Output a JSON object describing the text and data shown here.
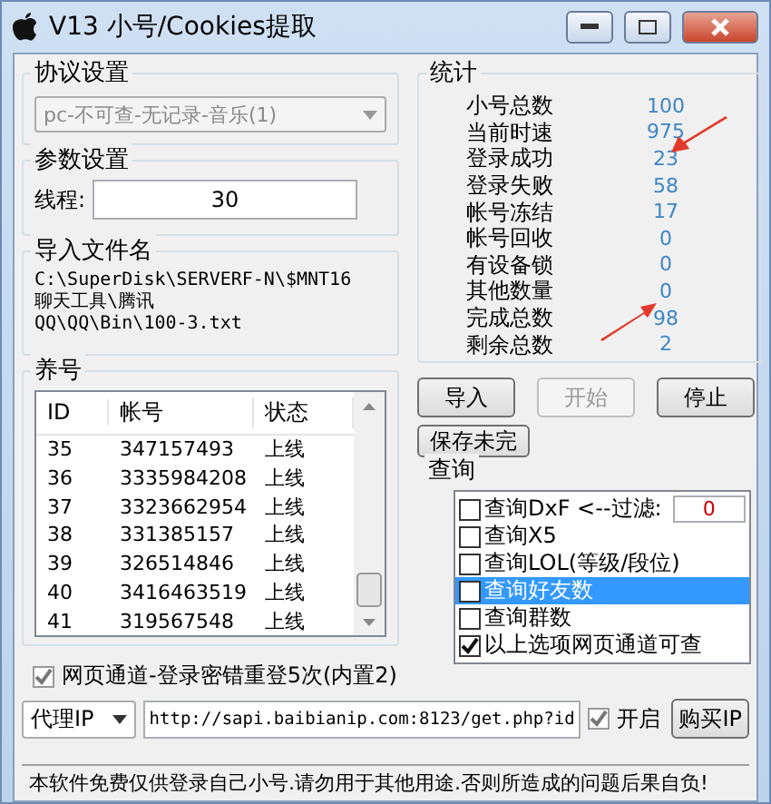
{
  "window": {
    "title": "V13 小号/Cookies提取"
  },
  "protocol": {
    "label": "协议设置",
    "value": "pc-不可查-无记录-音乐(1)",
    "disabled": true
  },
  "params": {
    "label": "参数设置",
    "thread_label": "线程:",
    "thread_value": "30"
  },
  "import_file": {
    "label": "导入文件名",
    "lines": [
      "C:\\SuperDisk\\SERVERF-N\\$MNT16",
      "聊天工具\\腾讯",
      "QQ\\QQ\\Bin\\100-3.txt"
    ]
  },
  "accounts": {
    "label": "养号",
    "columns": [
      "ID",
      "帐号",
      "状态"
    ],
    "rows": [
      [
        "35",
        "347157493",
        "上线"
      ],
      [
        "36",
        "3335984208",
        "上线"
      ],
      [
        "37",
        "3323662954",
        "上线"
      ],
      [
        "38",
        "331385157",
        "上线"
      ],
      [
        "39",
        "326514846",
        "上线"
      ],
      [
        "40",
        "3416463519",
        "上线"
      ],
      [
        "41",
        "319567548",
        "上线"
      ]
    ]
  },
  "stats": {
    "label": "统计",
    "items": [
      {
        "label": "小号总数",
        "value": "100"
      },
      {
        "label": "当前时速",
        "value": "975"
      },
      {
        "label": "登录成功",
        "value": "23"
      },
      {
        "label": "登录失败",
        "value": "58"
      },
      {
        "label": "帐号冻结",
        "value": "17"
      },
      {
        "label": "帐号回收",
        "value": "0"
      },
      {
        "label": "有设备锁",
        "value": "0"
      },
      {
        "label": "其他数量",
        "value": "0"
      },
      {
        "label": "完成总数",
        "value": "98"
      },
      {
        "label": "剩余总数",
        "value": "2"
      }
    ]
  },
  "buttons": [
    {
      "label": "导入",
      "disabled": false
    },
    {
      "label": "开始",
      "disabled": true
    },
    {
      "label": "停止",
      "disabled": false
    }
  ],
  "save_button": "保存未完",
  "query": {
    "label": "查询",
    "items": [
      {
        "label": "查询DxF <--过滤:",
        "checked": false,
        "selected": false,
        "filter_value": "0"
      },
      {
        "label": "查询X5",
        "checked": false,
        "selected": false
      },
      {
        "label": "查询LOL(等级/段位)",
        "checked": false,
        "selected": false
      },
      {
        "label": "查询好友数",
        "checked": false,
        "selected": true
      },
      {
        "label": "查询群数",
        "checked": false,
        "selected": false
      },
      {
        "label": "以上选项网页通道可查",
        "checked": true,
        "selected": false
      }
    ]
  },
  "relogin": {
    "label": "网页通道-登录密错重登5次(内置2)",
    "checked": true
  },
  "proxy": {
    "mode": "代理IP",
    "url": "http://sapi.baibianip.com:8123/get.php?id",
    "enable_label": "开启",
    "enable_checked": true,
    "buy_label": "购买IP"
  },
  "status_bar": "本软件免费仅供登录自己小号.请勿用于其他用途.否则所造成的问题后果自负!"
}
